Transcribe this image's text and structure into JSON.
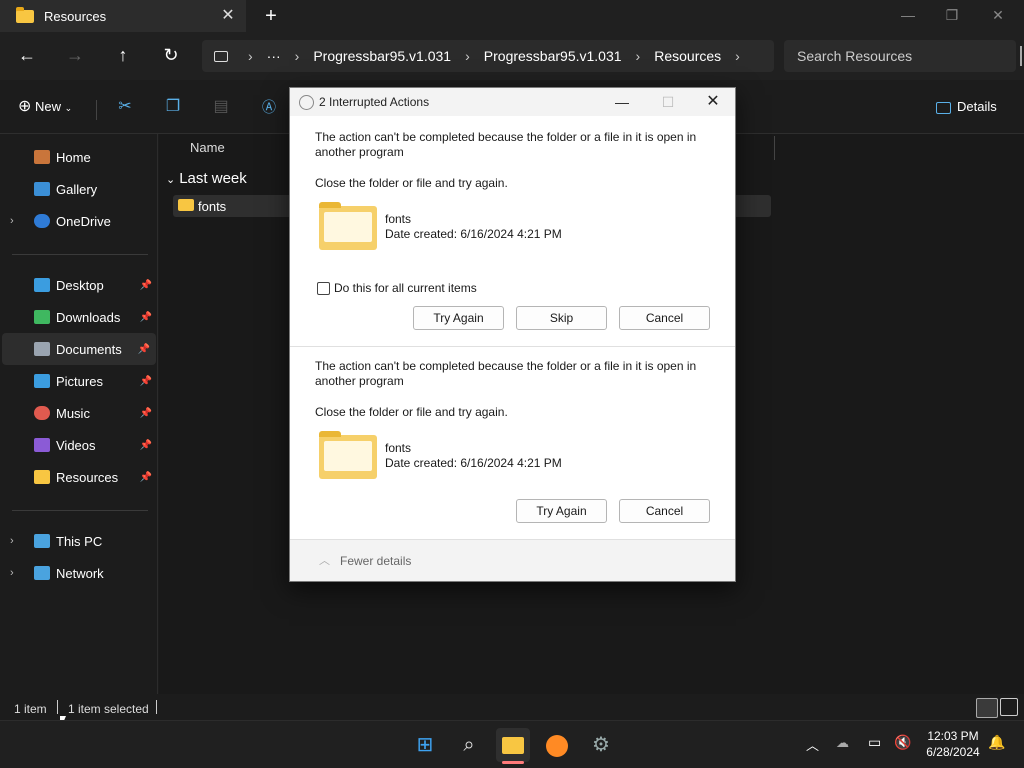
{
  "window": {
    "tab_title": "Resources",
    "new_tab": "+",
    "tab_close": "✕",
    "minimize": "—",
    "restore": "❐",
    "close": "✕"
  },
  "address": {
    "crumbs": [
      "Progressbar95.v1.031",
      "Progressbar95.v1.031",
      "Resources"
    ],
    "search_placeholder": "Search Resources"
  },
  "toolbar": {
    "new_label": "New",
    "details_label": "Details"
  },
  "sidebar": {
    "items": [
      {
        "label": "Home",
        "color": "#c9753b"
      },
      {
        "label": "Gallery",
        "color": "#3b8fd6"
      },
      {
        "label": "OneDrive",
        "color": "#2f7bd6"
      },
      {
        "label": "Desktop",
        "color": "#3b9de0"
      },
      {
        "label": "Downloads",
        "color": "#3fb860"
      },
      {
        "label": "Documents",
        "color": "#9aa4b0"
      },
      {
        "label": "Pictures",
        "color": "#3b9de0"
      },
      {
        "label": "Music",
        "color": "#e05a4f"
      },
      {
        "label": "Videos",
        "color": "#8b5bd6"
      },
      {
        "label": "Resources",
        "color": "#f8c642"
      },
      {
        "label": "This PC",
        "color": "#4aa3df"
      },
      {
        "label": "Network",
        "color": "#4aa3df"
      }
    ]
  },
  "content": {
    "column_name": "Name",
    "group": "Last week",
    "file": "fonts"
  },
  "status": {
    "count": "1 item",
    "selected": "1 item selected"
  },
  "dialog": {
    "title": "2 Interrupted Actions",
    "message": "The action can't be completed because the folder or a file in it is open in another program",
    "hint": "Close the folder or file and try again.",
    "item_name": "fonts",
    "date_created": "Date created: 6/16/2024 4:21 PM",
    "checkbox_label": "Do this for all current items",
    "try_again": "Try Again",
    "skip": "Skip",
    "cancel": "Cancel",
    "fewer_details": "Fewer details"
  },
  "taskbar": {
    "time": "12:03 PM",
    "date": "6/28/2024"
  }
}
